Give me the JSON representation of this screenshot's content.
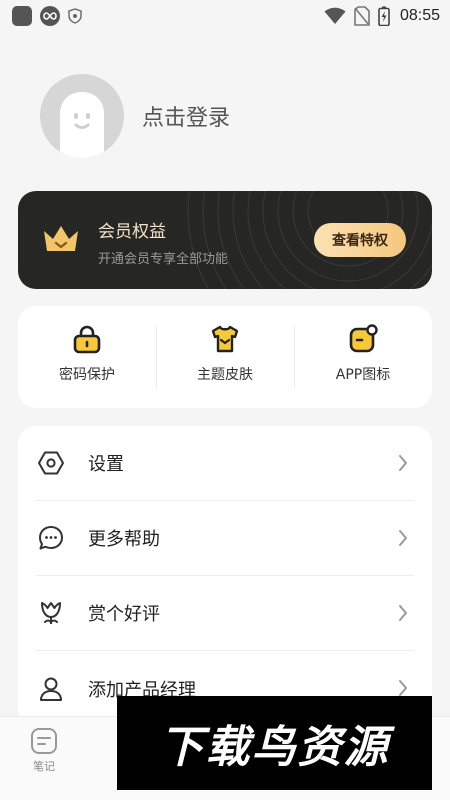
{
  "status_bar": {
    "time": "08:55",
    "icons": [
      "app-square-icon",
      "infinity-icon",
      "shield-icon",
      "wifi-icon",
      "no-sim-icon",
      "battery-charging-icon"
    ]
  },
  "profile": {
    "login_text": "点击登录",
    "avatar_icon": "ghost-avatar-icon"
  },
  "vip": {
    "title": "会员权益",
    "subtitle": "开通会员专享全部功能",
    "button_label": "查看特权",
    "icon": "crown-icon",
    "colors": {
      "card_bg": "#262624",
      "title": "#f4e3c8",
      "button_from": "#fbe2b4",
      "button_to": "#f5c77e",
      "crown": "#f3c56b"
    }
  },
  "features": [
    {
      "label": "密码保护",
      "icon": "lock-icon"
    },
    {
      "label": "主题皮肤",
      "icon": "tshirt-icon"
    },
    {
      "label": "APP图标",
      "icon": "app-badge-icon"
    }
  ],
  "menu": [
    {
      "label": "设置",
      "icon": "settings-hexagon-icon"
    },
    {
      "label": "更多帮助",
      "icon": "chat-bubble-icon"
    },
    {
      "label": "赏个好评",
      "icon": "tulip-icon"
    },
    {
      "label": "添加产品经理",
      "icon": "person-icon"
    }
  ],
  "bottom_nav": {
    "note_label": "笔记",
    "note_icon": "note-icon"
  },
  "watermark": {
    "text": "下载鸟资源"
  }
}
